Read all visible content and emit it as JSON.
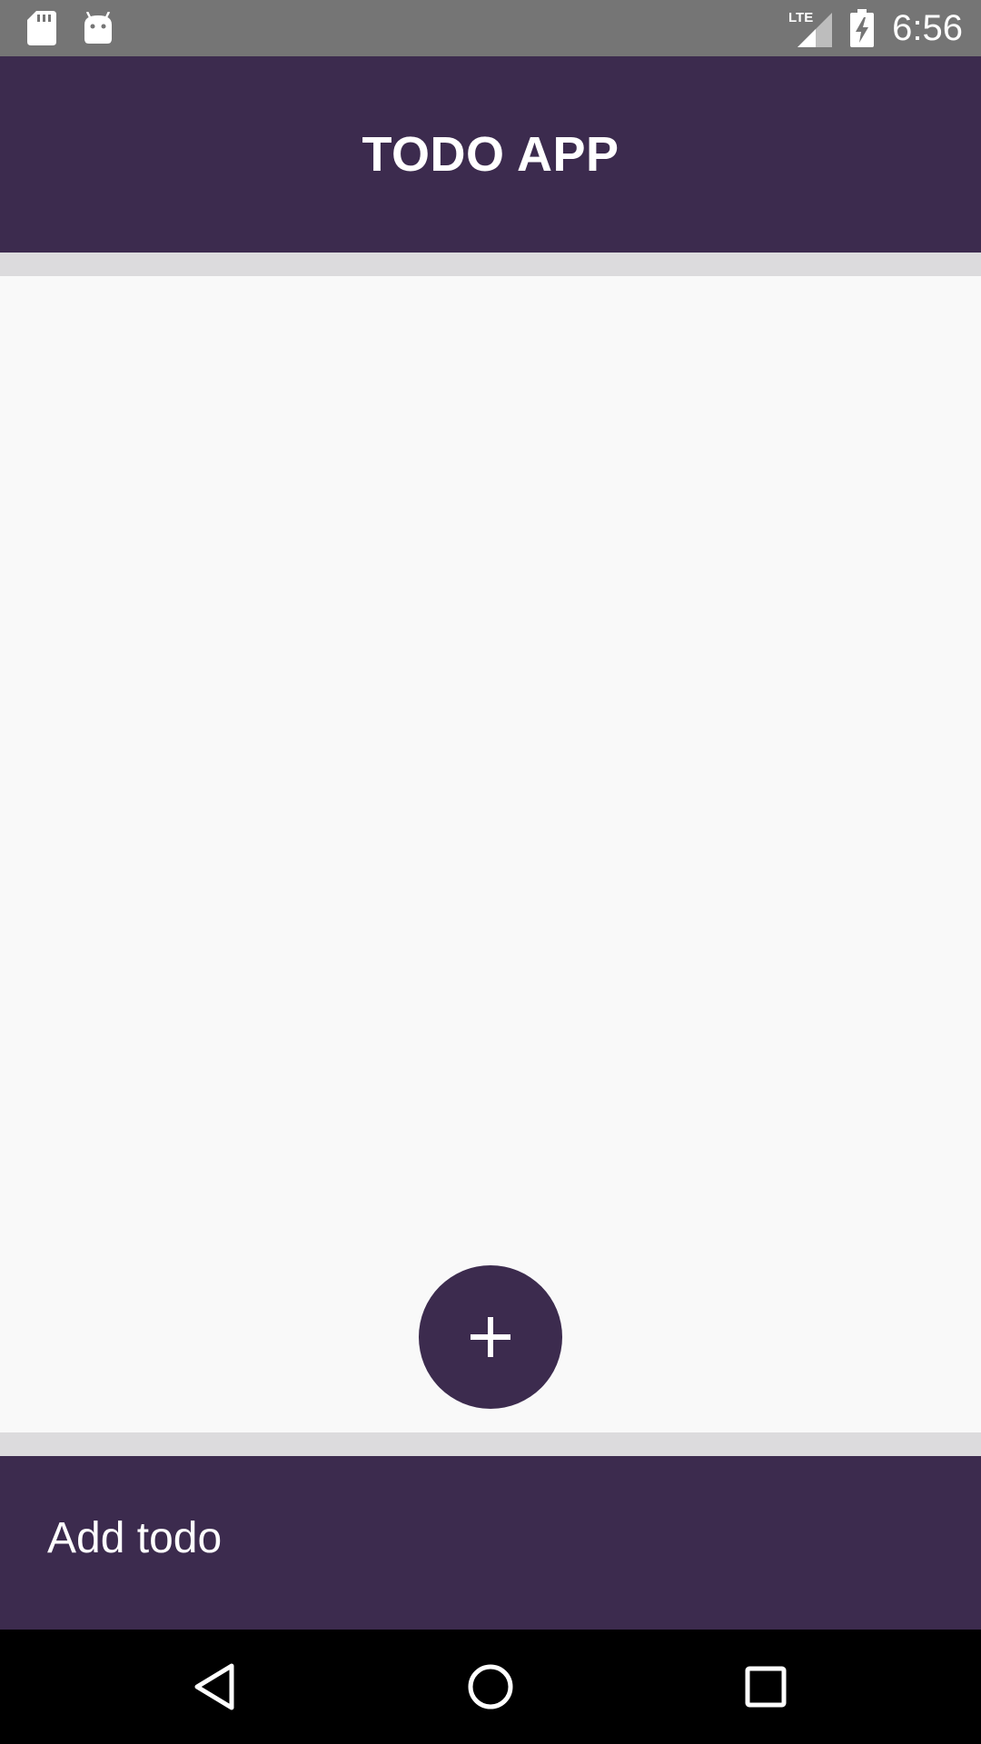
{
  "status_bar": {
    "time": "6:56",
    "left_icons": [
      "sd-card-icon",
      "android-icon"
    ],
    "right_icons": [
      "lte-signal-icon",
      "battery-charging-icon"
    ],
    "network_label": "LTE"
  },
  "app_bar": {
    "title": "TODO APP"
  },
  "todo_list": {
    "items": []
  },
  "fab": {
    "icon": "plus-icon"
  },
  "bottom_bar": {
    "add_todo_label": "Add todo"
  },
  "nav_bar": {
    "buttons": [
      "back-icon",
      "home-icon",
      "recents-icon"
    ]
  },
  "colors": {
    "primary": "#3c2b4e",
    "status_bar": "#757575",
    "list_background": "#f9f9f9",
    "divider": "#dcdbdd"
  }
}
